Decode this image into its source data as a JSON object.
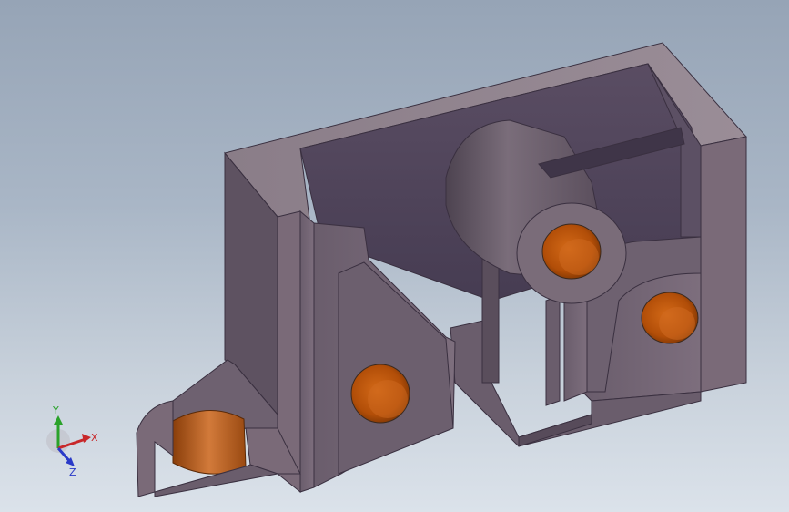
{
  "viewport": {
    "background_top": "#96a4b6",
    "background_bottom": "#dbe2ea"
  },
  "model": {
    "body_color": "#6e6170",
    "face_light_color": "#82727f",
    "face_dark_color": "#4f4458",
    "hole_color": "#c05a10",
    "hole_highlight": "#e07a2a"
  },
  "triad": {
    "x_label": "X",
    "y_label": "Y",
    "z_label": "Z",
    "x_color": "#c8282a",
    "y_color": "#2aa22a",
    "z_color": "#2a3ac8"
  }
}
